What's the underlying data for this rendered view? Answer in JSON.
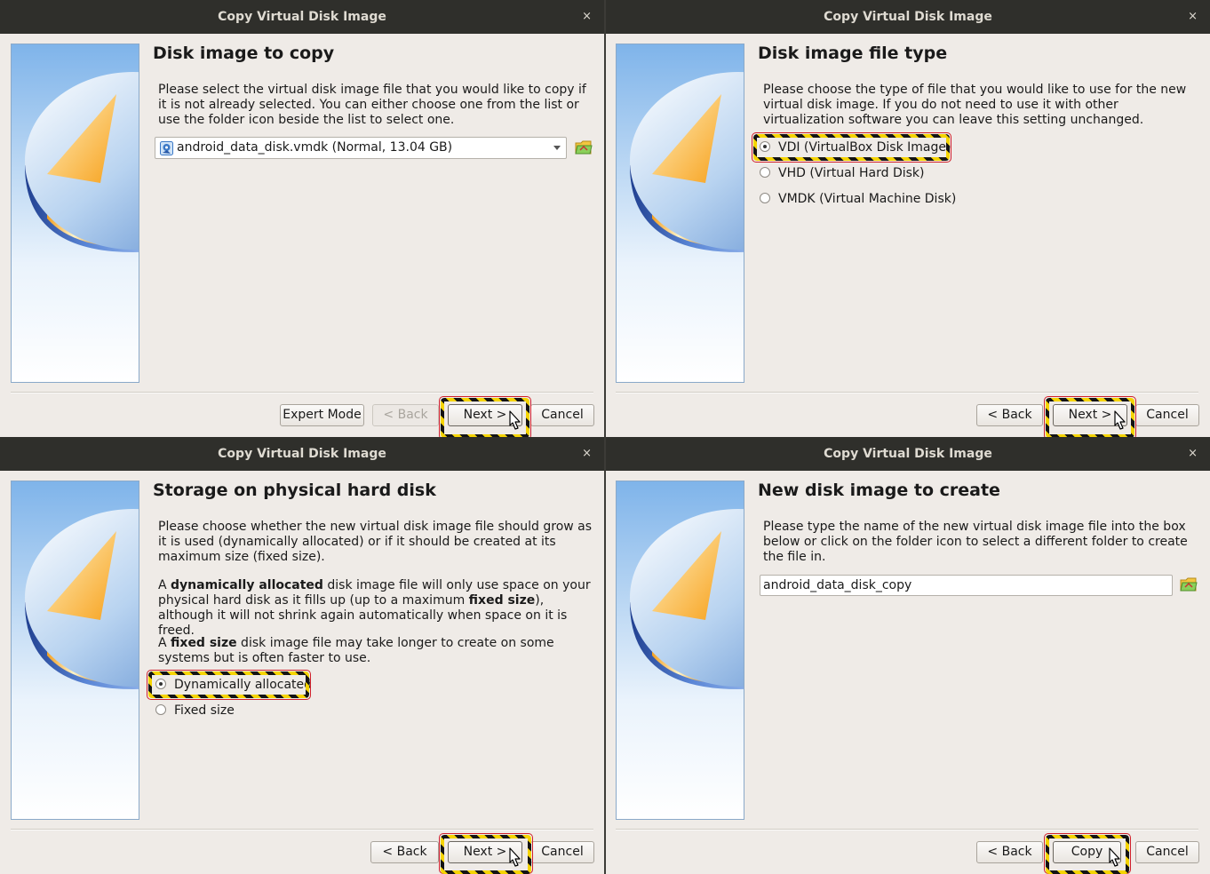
{
  "dialogs": [
    {
      "title": "Copy Virtual Disk Image",
      "close": "×",
      "heading": "Disk image to copy",
      "description": "Please select the virtual disk image file that you would like to copy if it is not already selected. You can either choose one from the list or use the folder icon beside the list to select one.",
      "combo_value": "android_data_disk.vmdk (Normal, 13.04 GB)",
      "buttons": {
        "expert": "Expert Mode",
        "back": "< Back",
        "next": "Next >",
        "cancel": "Cancel"
      }
    },
    {
      "title": "Copy Virtual Disk Image",
      "close": "×",
      "heading": "Disk image file type",
      "description": "Please choose the type of file that you would like to use for the new virtual disk image. If you do not need to use it with other virtualization software you can leave this setting unchanged.",
      "options": [
        {
          "label": "VDI (VirtualBox Disk Image)",
          "selected": true
        },
        {
          "label": "VHD (Virtual Hard Disk)",
          "selected": false
        },
        {
          "label": "VMDK (Virtual Machine Disk)",
          "selected": false
        }
      ],
      "buttons": {
        "back": "< Back",
        "next": "Next >",
        "cancel": "Cancel"
      }
    },
    {
      "title": "Copy Virtual Disk Image",
      "close": "×",
      "heading": "Storage on physical hard disk",
      "para1": "Please choose whether the new virtual disk image file should grow as it is used (dynamically allocated) or if it should be created at its maximum size (fixed size).",
      "para2": {
        "t1": "A ",
        "b1": "dynamically allocated",
        "t2": " disk image file will only use space on your physical hard disk as it fills up (up to a maximum ",
        "b2": "fixed size",
        "t3": "), although it will not shrink again automatically when space on it is freed."
      },
      "para3": {
        "t1": "A ",
        "b1": "fixed size",
        "t2": " disk image file may take longer to create on some systems but is often faster to use."
      },
      "options": [
        {
          "label": "Dynamically allocated",
          "selected": true
        },
        {
          "label": "Fixed size",
          "selected": false
        }
      ],
      "buttons": {
        "back": "< Back",
        "next": "Next >",
        "cancel": "Cancel"
      }
    },
    {
      "title": "Copy Virtual Disk Image",
      "close": "×",
      "heading": "New disk image to create",
      "description": "Please type the name of the new virtual disk image file into the box below or click on the folder icon to select a different folder to create the file in.",
      "filename": "android_data_disk_copy",
      "buttons": {
        "back": "< Back",
        "copy": "Copy",
        "cancel": "Cancel"
      }
    }
  ],
  "colors": {
    "titlebar": "#2f2f2b",
    "dialog_bg": "#efebe7",
    "highlight_yellow": "#f5d400",
    "highlight_black": "#141414"
  }
}
